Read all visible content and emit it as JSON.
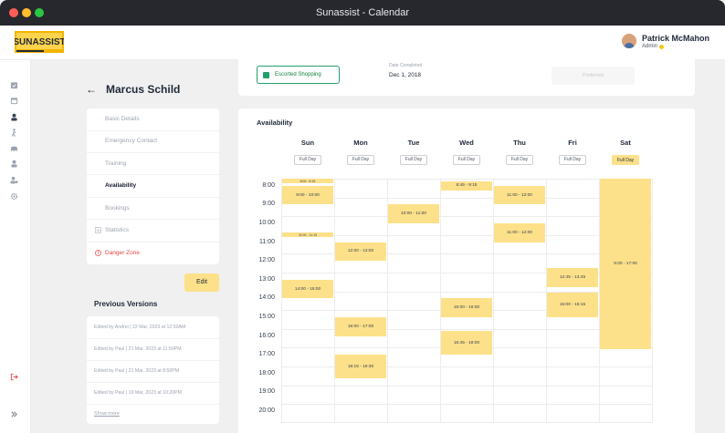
{
  "window": {
    "title": "Sunassist - Calendar"
  },
  "header": {
    "logo_text": "SUNASSIST",
    "user_name": "Patrick McMahon",
    "user_role": "Admin"
  },
  "sidebar": {
    "icons": [
      "calendar-check-icon",
      "calendar-icon",
      "user-badge-icon",
      "walking-person-icon",
      "car-icon",
      "person-icon",
      "users-settings-icon",
      "gear-icon"
    ],
    "bottom_icons": [
      "logout-icon",
      "expand-icon"
    ]
  },
  "profile": {
    "name": "Marcus Schild",
    "menu": [
      {
        "label": "Basic Details",
        "state": "normal"
      },
      {
        "label": "Emergency Contact",
        "state": "normal"
      },
      {
        "label": "Training",
        "state": "normal"
      },
      {
        "label": "Availability",
        "state": "active"
      },
      {
        "label": "Bookings",
        "state": "normal"
      },
      {
        "label": "Statistics",
        "state": "normal",
        "icon": "chart-icon"
      },
      {
        "label": "Danger Zone",
        "state": "danger",
        "icon": "warning-icon"
      }
    ],
    "edit_label": "Edit",
    "previous_versions_title": "Previous Versions",
    "versions": [
      "Edited by Andrei | 22 Mar, 2023 at 12:50AM",
      "Edited by Paul | 21 Mar, 2023 at 11:50PM",
      "Edited by Paul | 21 Mar, 2023 at 8:50PM",
      "Edited by Paul | 19 Mar, 2023 at 10:20PM"
    ],
    "show_more": "Show more"
  },
  "service": {
    "name": "Escorted Shopping",
    "date_completed_label": "Date Completed",
    "date_completed": "Dec 1, 2018",
    "preferred_placeholder": "Preferred"
  },
  "availability": {
    "title": "Availability",
    "full_day_label": "Full Day",
    "days": [
      "Sun",
      "Mon",
      "Tue",
      "Wed",
      "Thu",
      "Fri",
      "Sat"
    ],
    "full_day_selected": [
      false,
      false,
      false,
      false,
      false,
      false,
      true
    ],
    "times": [
      "8:00",
      "9:00",
      "10:00",
      "11:00",
      "12:00",
      "13:00",
      "14:00",
      "15:00",
      "16:00",
      "17:00",
      "18:00",
      "19:00",
      "20:00"
    ],
    "slots": [
      {
        "day": 0,
        "start": 7.5,
        "end": 7.75,
        "label": "8:00 - 8:15"
      },
      {
        "day": 0,
        "start": 8.0,
        "end": 9.0,
        "label": "9:00 - 10:00"
      },
      {
        "day": 0,
        "start": 10.5,
        "end": 10.75,
        "label": "11:00 - 11:15"
      },
      {
        "day": 0,
        "start": 13.0,
        "end": 14.0,
        "label": "14:00 - 15:00"
      },
      {
        "day": 1,
        "start": 11.0,
        "end": 12.0,
        "label": "12:00 - 13:00"
      },
      {
        "day": 1,
        "start": 15.0,
        "end": 16.0,
        "label": "16:00 - 17:00"
      },
      {
        "day": 1,
        "start": 17.0,
        "end": 18.25,
        "label": "18:15 - 19:30"
      },
      {
        "day": 2,
        "start": 9.0,
        "end": 10.0,
        "label": "10:00 - 11:00"
      },
      {
        "day": 3,
        "start": 7.75,
        "end": 8.25,
        "label": "8:45 - 9:15"
      },
      {
        "day": 3,
        "start": 14.0,
        "end": 15.0,
        "label": "15:00 - 16:00"
      },
      {
        "day": 3,
        "start": 15.75,
        "end": 17.0,
        "label": "16:45 - 18:00"
      },
      {
        "day": 4,
        "start": 8.0,
        "end": 9.0,
        "label": "11:00 - 12:00"
      },
      {
        "day": 4,
        "start": 10.0,
        "end": 11.0,
        "label": "11:00 - 12:00"
      },
      {
        "day": 5,
        "start": 12.4,
        "end": 13.4,
        "label": "12:45 - 13:45"
      },
      {
        "day": 5,
        "start": 13.7,
        "end": 15.0,
        "label": "15:00 - 16:15"
      },
      {
        "day": 6,
        "start": 7.6,
        "end": 16.7,
        "label": "8:00 - 17:00"
      }
    ]
  },
  "colors": {
    "accent_yellow": "#fde18a",
    "success_green": "#22a06b",
    "danger_red": "#ef4444"
  }
}
